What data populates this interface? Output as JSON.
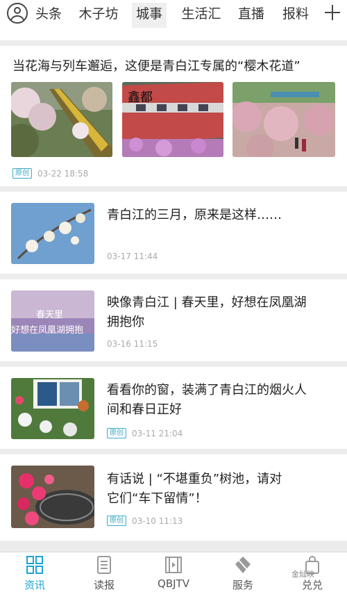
{
  "nav": {
    "tabs": [
      {
        "label": "头条"
      },
      {
        "label": "木子坊"
      },
      {
        "label": "城事"
      },
      {
        "label": "生活汇"
      },
      {
        "label": "直播"
      },
      {
        "label": "报料"
      }
    ],
    "active_tab": "城事"
  },
  "feed": {
    "featured": {
      "title": "当花海与列车邂逅，这便是青白江专属的“樱木花道”",
      "badge": "原创",
      "time": "03-22 18:58",
      "overlay_text": "鑫都"
    },
    "items": [
      {
        "title_line1": "青白江的三月，原来是这样……",
        "title_line2": "",
        "badge": "",
        "time": "03-17 11:44"
      },
      {
        "title_line1": "映像青白江 | 春天里，好想在凤凰湖",
        "title_line2": "拥抱你",
        "badge": "",
        "time": "03-16 11:15",
        "thumb_text1": "春天里",
        "thumb_text2": "好想在凤凰湖拥抱"
      },
      {
        "title_line1": "看看你的窗，装满了青白江的烟火人",
        "title_line2": "间和春日正好",
        "badge": "原创",
        "time": "03-11 21:04"
      },
      {
        "title_line1": "有话说 | “不堪重负”树池，请对",
        "title_line2": "它们“车下留情”！",
        "badge": "原创",
        "time": "03-10 11:13"
      }
    ]
  },
  "bottom_nav": {
    "items": [
      {
        "label": "资讯",
        "icon": "grid-icon"
      },
      {
        "label": "读报",
        "icon": "newspaper-icon"
      },
      {
        "label": "QBJTV",
        "icon": "film-icon"
      },
      {
        "label": "服务",
        "icon": "service-icon"
      },
      {
        "label": "兑兑",
        "icon": "bag-icon"
      }
    ],
    "active": "资讯"
  },
  "watermark": "金灿映",
  "colors": {
    "accent": "#1ba3d8",
    "badge": "#3aa9c9",
    "background": "#ececec"
  }
}
